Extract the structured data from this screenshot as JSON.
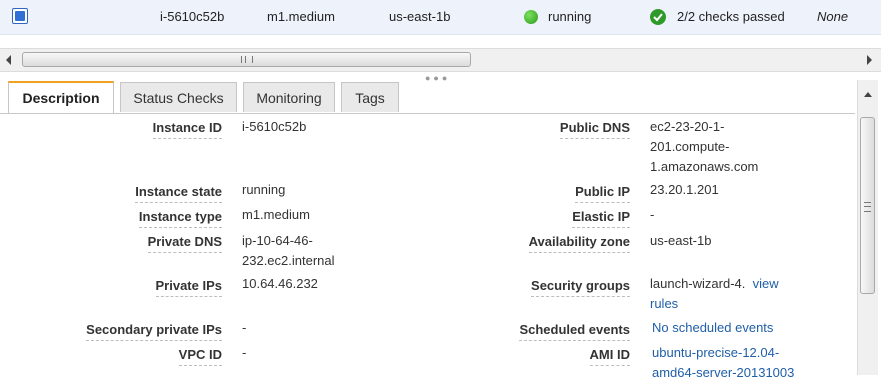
{
  "instance_row": {
    "instance_id": "i-5610c52b",
    "instance_type": "m1.medium",
    "availability_zone": "us-east-1b",
    "state": "running",
    "status_checks": "2/2 checks passed",
    "alarm_status": "None",
    "selected": true
  },
  "tabs": [
    "Description",
    "Status Checks",
    "Monitoring",
    "Tags"
  ],
  "details": {
    "instance_id": {
      "label": "Instance ID",
      "value": "i-5610c52b"
    },
    "instance_state": {
      "label": "Instance state",
      "value": "running"
    },
    "instance_type": {
      "label": "Instance type",
      "value": "m1.medium"
    },
    "private_dns": {
      "label": "Private DNS",
      "line1": "ip-10-64-46-",
      "line2": "232.ec2.internal"
    },
    "private_ips": {
      "label": "Private IPs",
      "value": "10.64.46.232"
    },
    "secondary_private_ips": {
      "label": "Secondary private IPs",
      "value": "-"
    },
    "vpc_id": {
      "label": "VPC ID",
      "value": "-"
    },
    "public_dns": {
      "label": "Public DNS",
      "line1": "ec2-23-20-1-",
      "line2": "201.compute-",
      "line3": "1.amazonaws.com"
    },
    "public_ip": {
      "label": "Public IP",
      "value": "23.20.1.201"
    },
    "elastic_ip": {
      "label": "Elastic IP",
      "value": "-"
    },
    "availability_zone": {
      "label": "Availability zone",
      "value": "us-east-1b"
    },
    "security_groups": {
      "label": "Security groups",
      "group": "launch-wizard-4.",
      "view": "view",
      "rules": "rules"
    },
    "scheduled_events": {
      "label": "Scheduled events",
      "value": "No scheduled events"
    },
    "ami_id": {
      "label": "AMI ID",
      "line1": "ubuntu-precise-12.04-",
      "line2": "amd64-server-20131003"
    }
  },
  "colors": {
    "running": "#2e9a1c",
    "checks_passed": "#2f9a2a",
    "link": "#1f5fa8",
    "active_tab_accent": "#f0a21e",
    "selected_row": "#eef3fb"
  },
  "icons": {
    "checkbox": "checkbox-checked-icon",
    "state": "green-dot-icon",
    "checks": "green-checkmark-icon",
    "scroll_left": "arrow-left-icon",
    "scroll_right": "arrow-right-icon",
    "scroll_up": "arrow-up-icon"
  }
}
